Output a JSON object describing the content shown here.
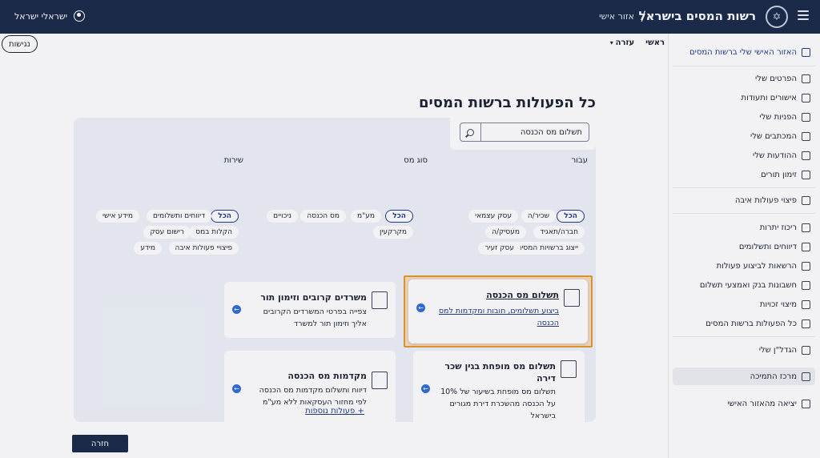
{
  "topbar": {
    "brand": "רשות המסים בישראל",
    "separator": "/",
    "subtitle": "אזור אישי",
    "user_name": "ישראלי ישראל"
  },
  "sidebar": {
    "home": "האזור האישי שלי ברשות המסים",
    "items": [
      "הפרטים שלי",
      "אישורים ותעודות",
      "הפניות שלי",
      "המכתבים שלי",
      "ההודעות שלי",
      "זימון תורים",
      "פיצוי פעולות איבה",
      "ריכוז יתרות",
      "דיווחים ותשלומים",
      "הרשאות לביצוע פעולות",
      "חשבונות בנק ואמצעי תשלום",
      "מיצוי זכויות",
      "כל הפעולות ברשות המסים",
      "הגדל\"ן שלי",
      "מרכז התמיכה",
      "יציאה מהאזור האישי"
    ]
  },
  "breadcrumbs": {
    "home": "ראשי",
    "help": "עזרה"
  },
  "accessibility": "נגישות",
  "page_title": "כל הפעולות ברשות המסים",
  "search": {
    "value": "תשלום מס הכנסה"
  },
  "filters": {
    "for_title": "עבור",
    "for": [
      "הכל",
      "שכיר/ה",
      "עסק עצמאי",
      "חברה/תאגיד",
      "מעסיק/ה",
      "ייצוג ברשויות המסים",
      "עסק זעיר"
    ],
    "tax_title": "סוג מס",
    "tax": [
      "הכל",
      "מע\"מ",
      "מס הכנסה",
      "ניכויים",
      "מקרקעין"
    ],
    "service_title": "שירות",
    "service": [
      "הכל",
      "דיווחים ותשלומים",
      "מידע אישי",
      "הקלות במס",
      "רישום עסק",
      "פיצויי פעולות איבה",
      "מידע"
    ]
  },
  "cards": {
    "c1": {
      "title": "תשלום מס הכנסה",
      "desc1": "ביצוע תשלומים, חובות ומקדמות למס",
      "desc2": "הכנסה"
    },
    "c2": {
      "title": "משרדים קרובים וזימון תור",
      "desc1": "צפייה בפרטי המשרדים הקרובים",
      "desc2": "אליך וזימון תור למשרד"
    },
    "c3": {
      "title1": "תשלום מס מופחת בגין שכר",
      "title2": "דירה",
      "desc1": "תשלום מס מופחת בשיעור של 10%",
      "desc2": "על הכנסה מהשכרת דירת מגורים",
      "desc3": "בישראל"
    },
    "c4": {
      "title": "מקדמות מס הכנסה",
      "desc1": "דיווח ותשלום מקדמות מס הכנסה",
      "desc2": "לפי מחזור העסקאות ללא מע\"מ"
    }
  },
  "more_actions": "+ פעולות נוספות",
  "back": "חזרה",
  "colors": {
    "navy": "#1b2b4a",
    "link": "#1f3b8a",
    "highlight": "#e59a2f",
    "arrow": "#2f6ed8"
  }
}
